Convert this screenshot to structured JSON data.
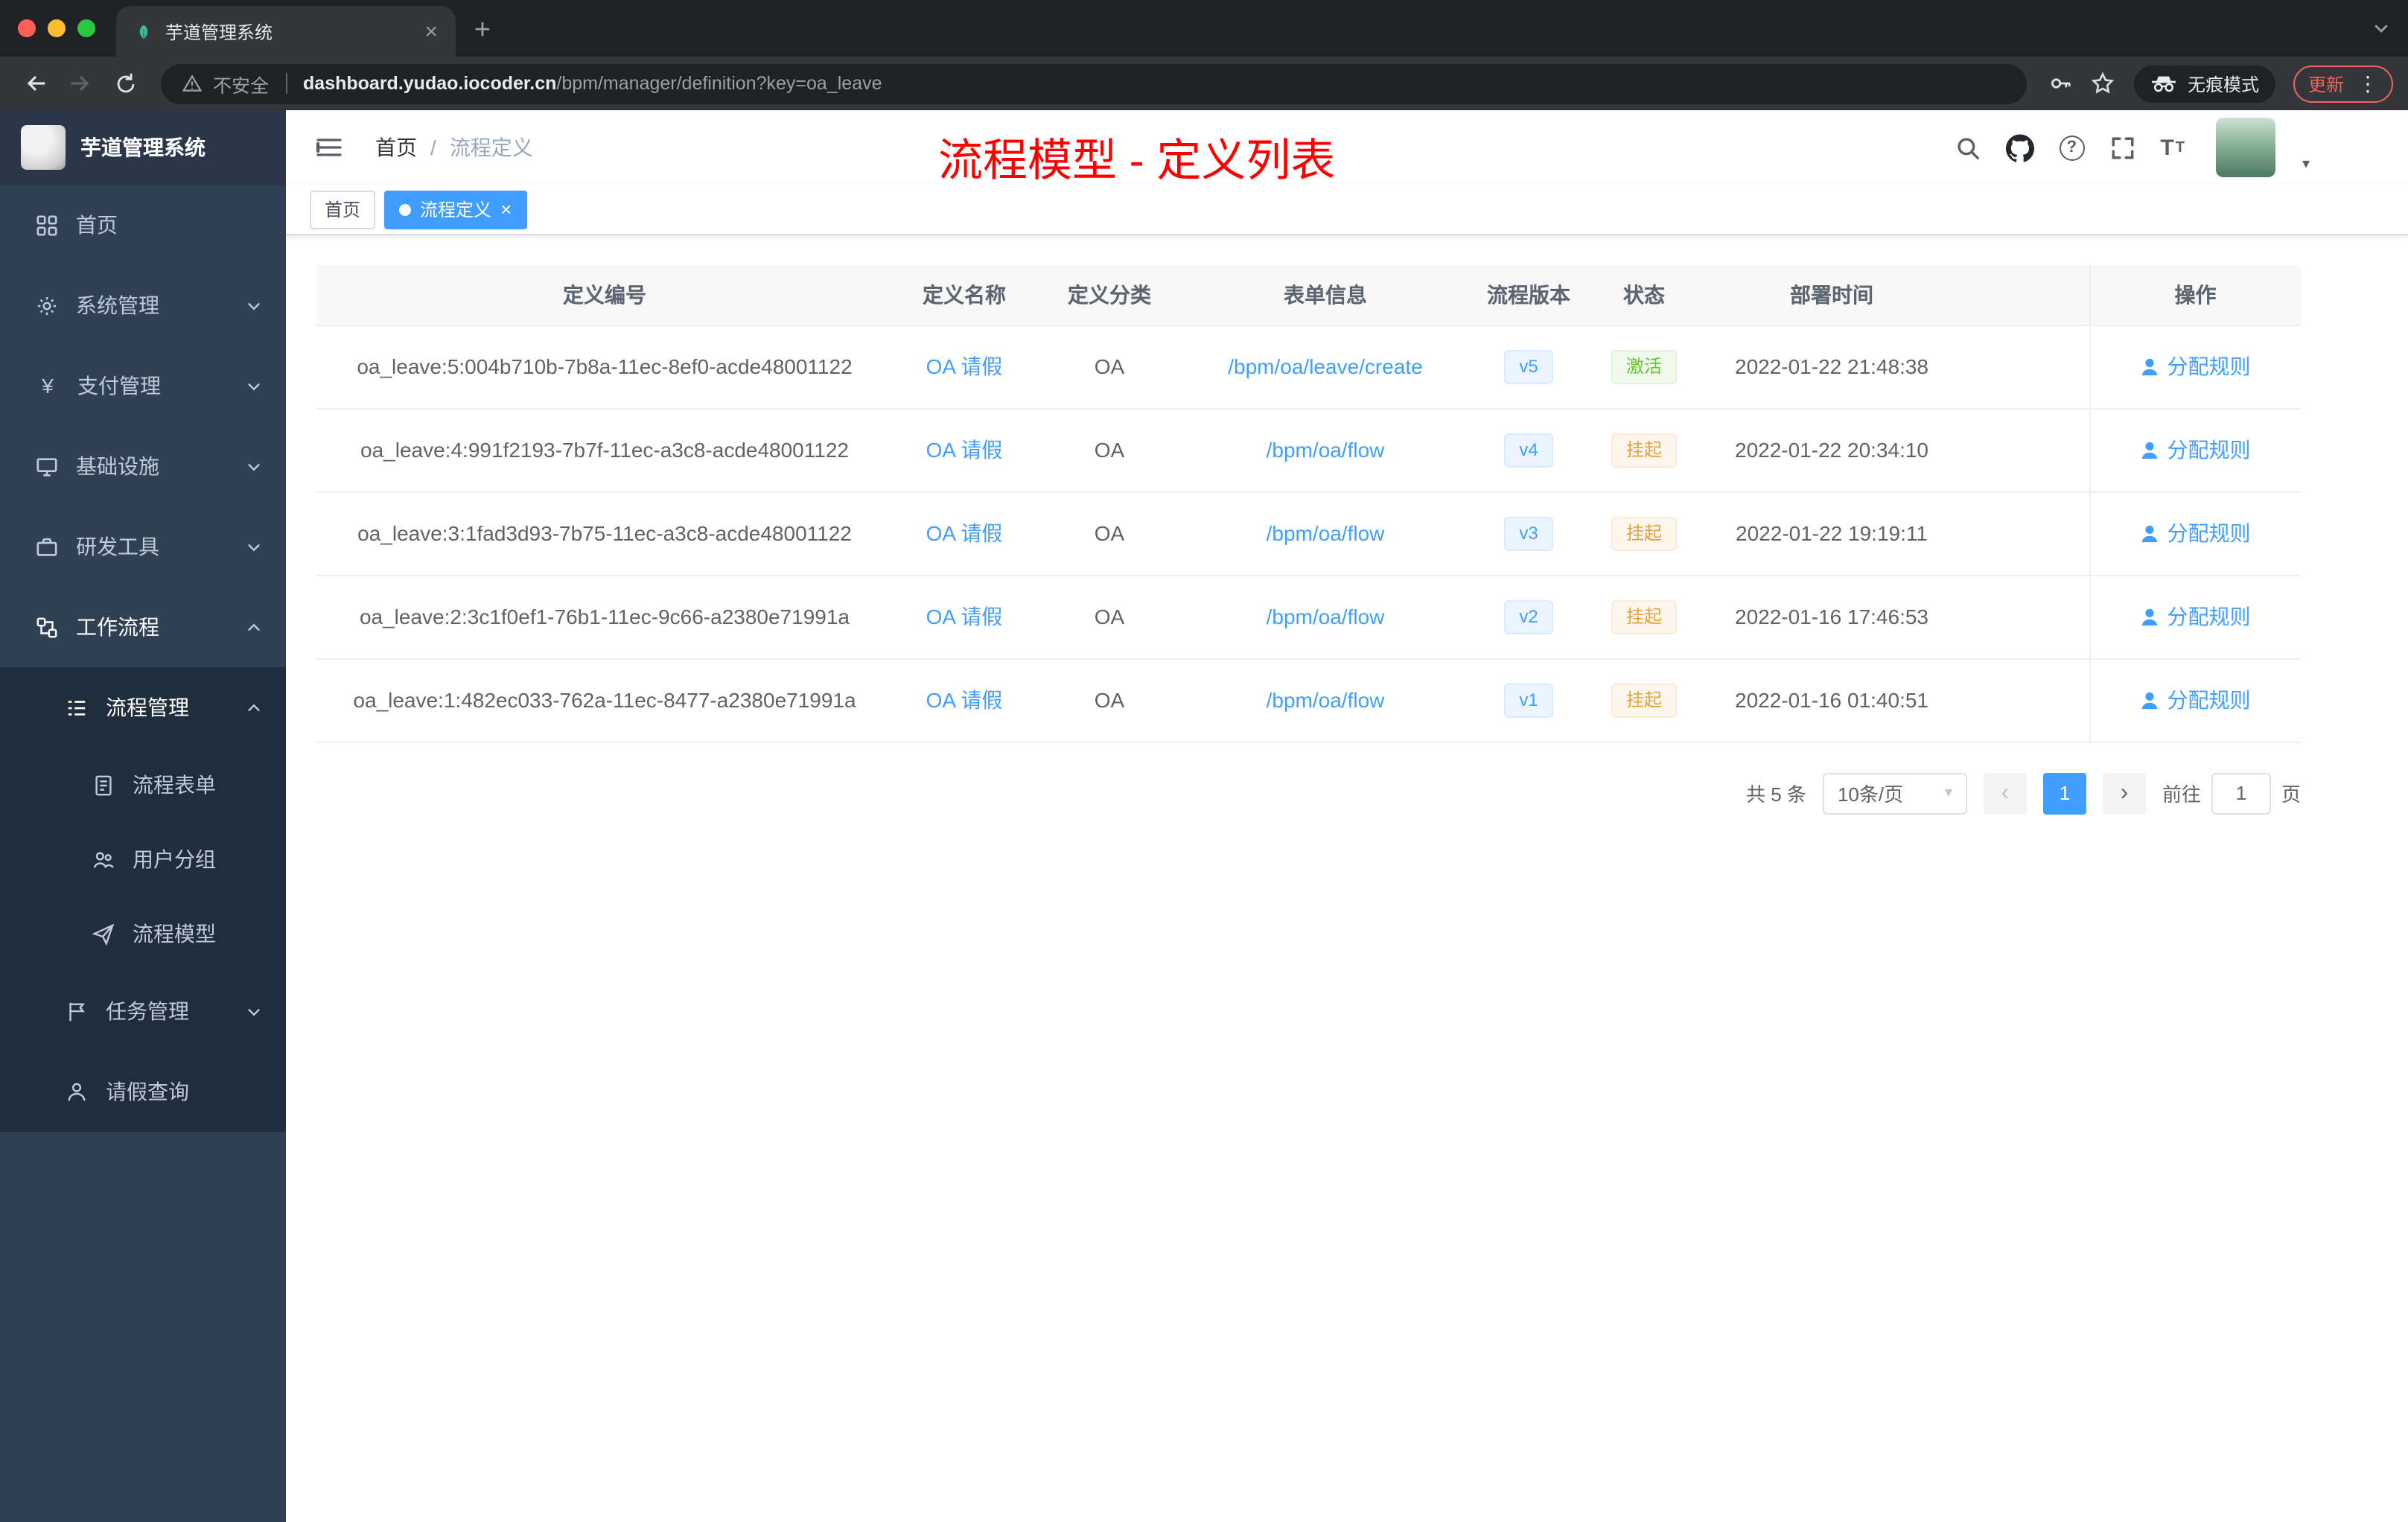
{
  "colors": {
    "primary": "#409EFF",
    "success": "#67C23A",
    "warning": "#E6A23C",
    "annotation_red": "#FF0000",
    "sidebar_bg": "#304156",
    "submenu_bg": "#1F2D3D"
  },
  "icons": {
    "tab_close": "×",
    "new_tab": "+",
    "yen": "¥",
    "help": "?",
    "font_size": "T",
    "dots": "⋮",
    "caret_down": "▾",
    "tag_close": "×"
  },
  "browser": {
    "tab_title": "芋道管理系统",
    "security_label": "不安全",
    "url_host": "dashboard.yudao.iocoder.cn",
    "url_path": "/bpm/manager/definition?key=oa_leave",
    "incognito_label": "无痕模式",
    "update_label": "更新"
  },
  "sidebar": {
    "logo_title": "芋道管理系统",
    "items": [
      {
        "label": "首页"
      },
      {
        "label": "系统管理"
      },
      {
        "label": "支付管理"
      },
      {
        "label": "基础设施"
      },
      {
        "label": "研发工具"
      },
      {
        "label": "工作流程"
      },
      {
        "label": "流程管理"
      },
      {
        "label": "流程表单"
      },
      {
        "label": "用户分组"
      },
      {
        "label": "流程模型"
      },
      {
        "label": "任务管理"
      },
      {
        "label": "请假查询"
      }
    ]
  },
  "header": {
    "breadcrumb_home": "首页",
    "breadcrumb_sep": "/",
    "breadcrumb_current": "流程定义",
    "annotation": "流程模型 - 定义列表"
  },
  "tags": {
    "home": "首页",
    "active": "流程定义"
  },
  "table": {
    "columns": [
      "定义编号",
      "定义名称",
      "定义分类",
      "表单信息",
      "流程版本",
      "状态",
      "部署时间",
      "操作"
    ],
    "action_label": "分配规则",
    "rows": [
      {
        "id": "oa_leave:5:004b710b-7b8a-11ec-8ef0-acde48001122",
        "name": "OA 请假",
        "category": "OA",
        "form": "/bpm/oa/leave/create",
        "version": "v5",
        "status": "激活",
        "deployed": "2022-01-22 21:48:38"
      },
      {
        "id": "oa_leave:4:991f2193-7b7f-11ec-a3c8-acde48001122",
        "name": "OA 请假",
        "category": "OA",
        "form": "/bpm/oa/flow",
        "version": "v4",
        "status": "挂起",
        "deployed": "2022-01-22 20:34:10"
      },
      {
        "id": "oa_leave:3:1fad3d93-7b75-11ec-a3c8-acde48001122",
        "name": "OA 请假",
        "category": "OA",
        "form": "/bpm/oa/flow",
        "version": "v3",
        "status": "挂起",
        "deployed": "2022-01-22 19:19:11"
      },
      {
        "id": "oa_leave:2:3c1f0ef1-76b1-11ec-9c66-a2380e71991a",
        "name": "OA 请假",
        "category": "OA",
        "form": "/bpm/oa/flow",
        "version": "v2",
        "status": "挂起",
        "deployed": "2022-01-16 17:46:53"
      },
      {
        "id": "oa_leave:1:482ec033-762a-11ec-8477-a2380e71991a",
        "name": "OA 请假",
        "category": "OA",
        "form": "/bpm/oa/flow",
        "version": "v1",
        "status": "挂起",
        "deployed": "2022-01-16 01:40:51"
      }
    ]
  },
  "pagination": {
    "total": "共 5 条",
    "page_size": "10条/页",
    "prev": "‹",
    "page": "1",
    "next": "›",
    "goto_label": "前往",
    "goto_value": "1",
    "goto_unit": "页"
  }
}
